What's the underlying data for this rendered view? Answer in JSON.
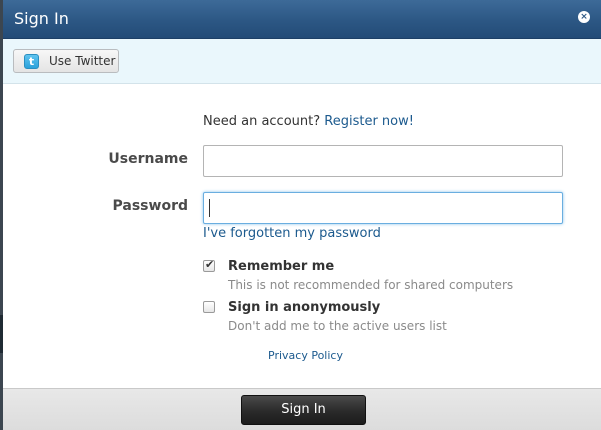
{
  "dialog": {
    "title": "Sign In",
    "close_icon": "close-icon",
    "close_glyph": "×"
  },
  "social": {
    "twitter_label": "Use Twitter",
    "twitter_icon": "twitter-icon",
    "twitter_glyph": "t"
  },
  "form": {
    "register_prompt": "Need an account?",
    "register_link": "Register now!",
    "username_label": "Username",
    "username_value": "",
    "password_label": "Password",
    "password_value": "",
    "forgot_link": "I've forgotten my password",
    "remember": {
      "title": "Remember me",
      "hint": "This is not recommended for shared computers",
      "checked": true
    },
    "anonymous": {
      "title": "Sign in anonymously",
      "hint": "Don't add me to the active users list",
      "checked": false
    },
    "privacy_link": "Privacy Policy"
  },
  "footer": {
    "signin_label": "Sign In"
  },
  "colors": {
    "titlebar": "#2c5784",
    "link": "#1c5a8e",
    "social_bar": "#eaf7fc",
    "signin_button": "#2a2a2a"
  }
}
